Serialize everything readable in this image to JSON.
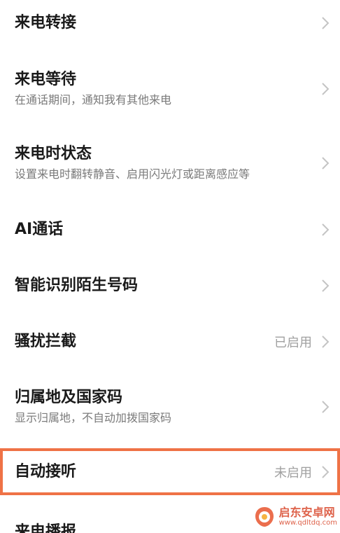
{
  "settings": {
    "items": [
      {
        "title": "来电转接",
        "subtitle": "",
        "value": ""
      },
      {
        "title": "来电等待",
        "subtitle": "在通话期间，通知我有其他来电",
        "value": ""
      },
      {
        "title": "来电时状态",
        "subtitle": "设置来电时翻转静音、启用闪光灯或距离感应等",
        "value": ""
      },
      {
        "title": "AI通话",
        "subtitle": "",
        "value": ""
      },
      {
        "title": "智能识别陌生号码",
        "subtitle": "",
        "value": ""
      },
      {
        "title": "骚扰拦截",
        "subtitle": "",
        "value": "已启用"
      },
      {
        "title": "归属地及国家码",
        "subtitle": "显示归属地，不自动加拨国家码",
        "value": ""
      },
      {
        "title": "自动接听",
        "subtitle": "",
        "value": "未启用"
      },
      {
        "title": "来电播报",
        "subtitle": "",
        "value": ""
      }
    ]
  },
  "icons": {
    "chevron": "chevron-right-icon"
  },
  "colors": {
    "highlight": "#ef7246",
    "title": "#1a1a1a",
    "subtitle": "#7a7a7a",
    "value": "#a0a0a0",
    "chevron": "#c4c4c4"
  },
  "watermark": {
    "title": "启东安卓网",
    "url": "www.qdltdq.com"
  }
}
